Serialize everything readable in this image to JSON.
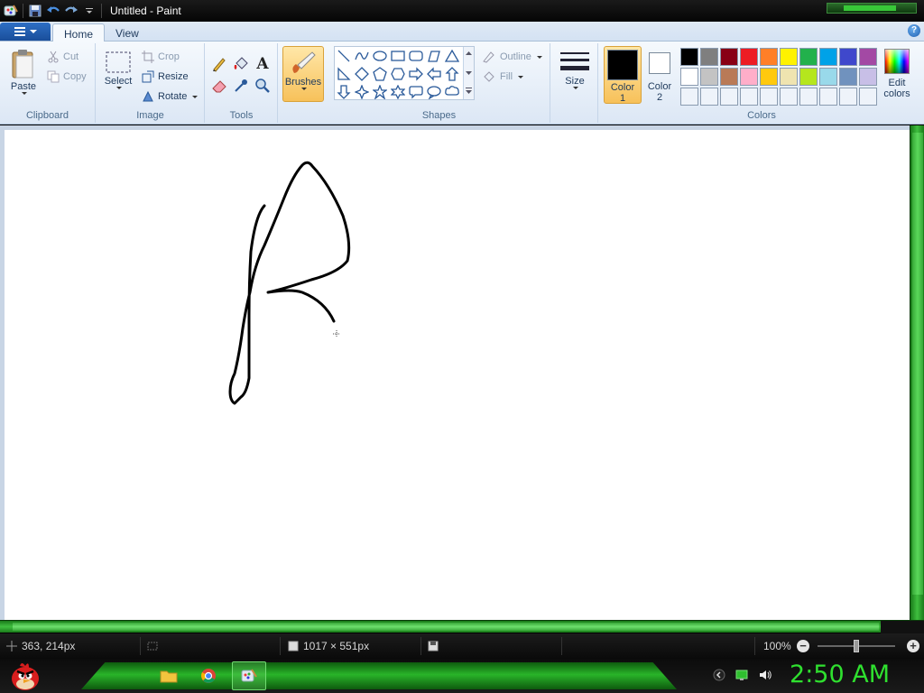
{
  "window": {
    "title": "Untitled - Paint"
  },
  "tabs": {
    "home": "Home",
    "view": "View"
  },
  "ribbon": {
    "clipboard": {
      "label": "Clipboard",
      "paste": "Paste",
      "cut": "Cut",
      "copy": "Copy"
    },
    "image": {
      "label": "Image",
      "select": "Select",
      "crop": "Crop",
      "resize": "Resize",
      "rotate": "Rotate"
    },
    "tools": {
      "label": "Tools"
    },
    "brushes": {
      "label": "Brushes"
    },
    "shapes": {
      "label": "Shapes",
      "outline": "Outline",
      "fill": "Fill"
    },
    "size": {
      "label": "Size"
    },
    "colors": {
      "label": "Colors",
      "color1_a": "Color",
      "color1_b": "1",
      "color2_a": "Color",
      "color2_b": "2",
      "edit_a": "Edit",
      "edit_b": "colors",
      "color1_value": "#000000",
      "color2_value": "#ffffff",
      "palette_row1": [
        "#000000",
        "#7f7f7f",
        "#880015",
        "#ed1c24",
        "#ff7f27",
        "#fff200",
        "#22b14c",
        "#00a2e8",
        "#3f48cc",
        "#a349a4"
      ],
      "palette_row2": [
        "#ffffff",
        "#c3c3c3",
        "#b97a57",
        "#ffaec9",
        "#ffc90e",
        "#efe4b0",
        "#b5e61d",
        "#99d9ea",
        "#7092be",
        "#c8bfe7"
      ],
      "palette_row3": [
        "#eef3fa",
        "#eef3fa",
        "#eef3fa",
        "#eef3fa",
        "#eef3fa",
        "#eef3fa",
        "#eef3fa",
        "#eef3fa",
        "#eef3fa",
        "#eef3fa"
      ]
    }
  },
  "status": {
    "cursor_pos": "363, 214px",
    "canvas_size": "1017 × 551px",
    "zoom": "100%"
  },
  "taskbar": {
    "clock": "2:50 AM"
  }
}
